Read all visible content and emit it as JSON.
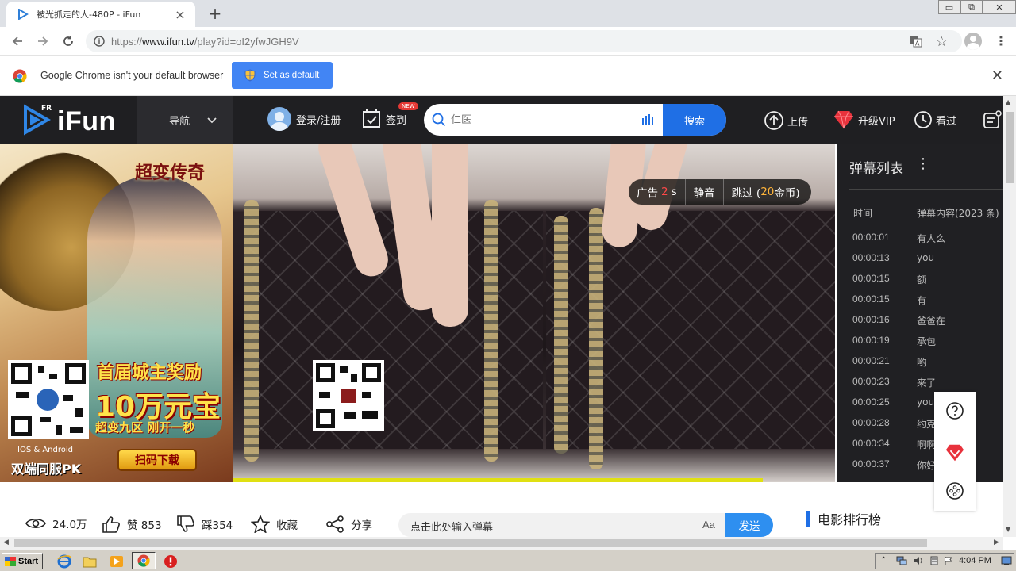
{
  "browser": {
    "tab_title": "被光抓走的人-480P - iFun",
    "new_tab_symbol": "+",
    "url_prefix": "https://",
    "url_host": "www.ifun.tv",
    "url_path": "/play?id=oI2yfwJGH9V",
    "window_controls": [
      "▭",
      "⧉",
      "✕"
    ]
  },
  "infobar": {
    "message": "Google Chrome isn't your default browser",
    "button_label": "Set as default"
  },
  "header": {
    "logo_fr": "FR",
    "logo_text": "iFun",
    "nav_label": "导航",
    "login_label": "登录/注册",
    "signin_label": "签到",
    "new_badge": "NEW",
    "search_placeholder": "仁医",
    "search_button": "搜索",
    "upload_label": "上传",
    "vip_label": "升级VIP",
    "history_label": "看过"
  },
  "left_ad": {
    "game_title": "超变传奇",
    "promo_line1": "首届城主奖励",
    "promo_line2": "10万元宝",
    "promo_line3": "超变九区 刚开一秒",
    "scan_button": "扫码下载",
    "platform": "IOS & Android",
    "pk": "双端同服PK"
  },
  "video": {
    "ad_label": "广告",
    "ad_seconds": "2",
    "ad_unit": "s",
    "mute_label": "静音",
    "skip_prefix": "跳过 (",
    "skip_coins": "20",
    "skip_suffix": "金币)",
    "progress": 0.88
  },
  "danmaku": {
    "title": "弹幕列表",
    "more_symbol": "⋮",
    "col_time": "时间",
    "col_content": "弹幕内容(2023 条)",
    "rows": [
      {
        "time": "00:00:01",
        "text": "有人么"
      },
      {
        "time": "00:00:13",
        "text": "you"
      },
      {
        "time": "00:00:15",
        "text": "额"
      },
      {
        "time": "00:00:15",
        "text": "有"
      },
      {
        "time": "00:00:16",
        "text": "爸爸在"
      },
      {
        "time": "00:00:19",
        "text": "承包"
      },
      {
        "time": "00:00:21",
        "text": "哟"
      },
      {
        "time": "00:00:23",
        "text": "来了"
      },
      {
        "time": "00:00:25",
        "text": "you"
      },
      {
        "time": "00:00:28",
        "text": "约克"
      },
      {
        "time": "00:00:34",
        "text": "啊啊"
      },
      {
        "time": "00:00:37",
        "text": "你好"
      }
    ]
  },
  "actions": {
    "views": "24.0万",
    "likes": "赞 853",
    "dislikes": "踩354",
    "favorite": "收藏",
    "share": "分享",
    "danmaku_placeholder": "点击此处输入弹幕",
    "font_toggle": "Aa",
    "send": "发送",
    "ranking": "电影排行榜"
  },
  "taskbar": {
    "start": "Start",
    "clock": "4:04 PM"
  },
  "colors": {
    "header_bg": "#1f1f22",
    "accent_blue": "#1f6fe5",
    "send_blue": "#2e8ff0",
    "chrome_blue": "#4285f4"
  }
}
